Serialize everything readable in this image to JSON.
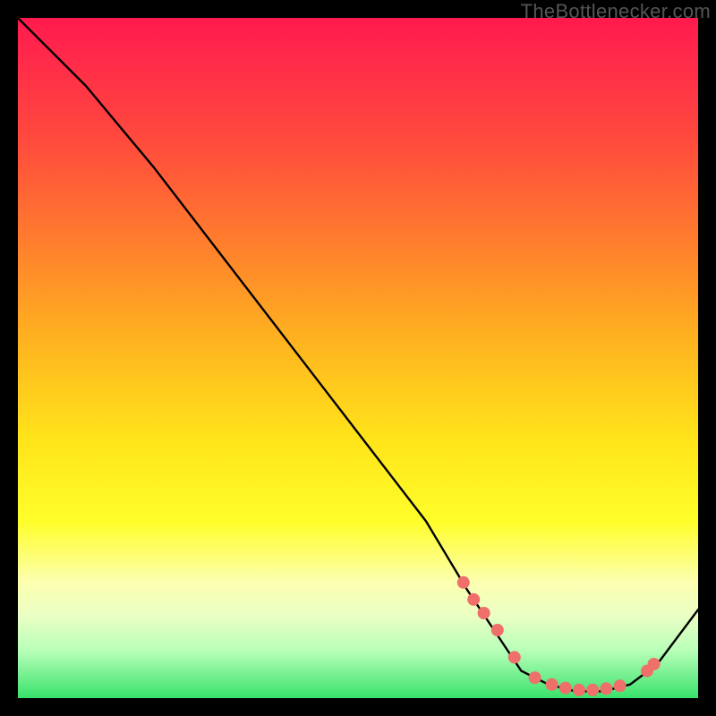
{
  "watermark": "TheBottlenecker.com",
  "chart_data": {
    "type": "line",
    "title": "",
    "xlabel": "",
    "ylabel": "",
    "xlim": [
      0,
      100
    ],
    "ylim": [
      0,
      100
    ],
    "series": [
      {
        "name": "bottleneck-curve",
        "x": [
          0,
          6,
          10,
          20,
          30,
          40,
          50,
          60,
          66,
          70,
          74,
          78,
          82,
          86,
          90,
          94,
          100
        ],
        "y": [
          100,
          94,
          90,
          78,
          65,
          52,
          39,
          26,
          16,
          10,
          4,
          2,
          1,
          1,
          2,
          5,
          13
        ]
      }
    ],
    "markers": {
      "name": "highlight-cluster",
      "x": [
        65.5,
        67.0,
        68.5,
        70.5,
        73.0,
        76.0,
        78.5,
        80.5,
        82.5,
        84.5,
        86.5,
        88.5,
        92.5,
        93.5
      ],
      "y": [
        17.0,
        14.5,
        12.5,
        10.0,
        6.0,
        3.0,
        2.0,
        1.5,
        1.2,
        1.2,
        1.4,
        1.8,
        4.0,
        5.0
      ]
    },
    "gradient_stops": [
      {
        "pct": 0,
        "color": "#ff1a4d"
      },
      {
        "pct": 6,
        "color": "#ff2a4a"
      },
      {
        "pct": 18,
        "color": "#ff4a3d"
      },
      {
        "pct": 32,
        "color": "#ff7a2e"
      },
      {
        "pct": 48,
        "color": "#ffb51f"
      },
      {
        "pct": 62,
        "color": "#ffe41a"
      },
      {
        "pct": 74,
        "color": "#fffe2a"
      },
      {
        "pct": 83,
        "color": "#fcffb0"
      },
      {
        "pct": 88,
        "color": "#eaffc4"
      },
      {
        "pct": 93,
        "color": "#b8ffb8"
      },
      {
        "pct": 100,
        "color": "#38e26b"
      }
    ],
    "marker_color": "#ef6f6a",
    "marker_radius": 7
  }
}
